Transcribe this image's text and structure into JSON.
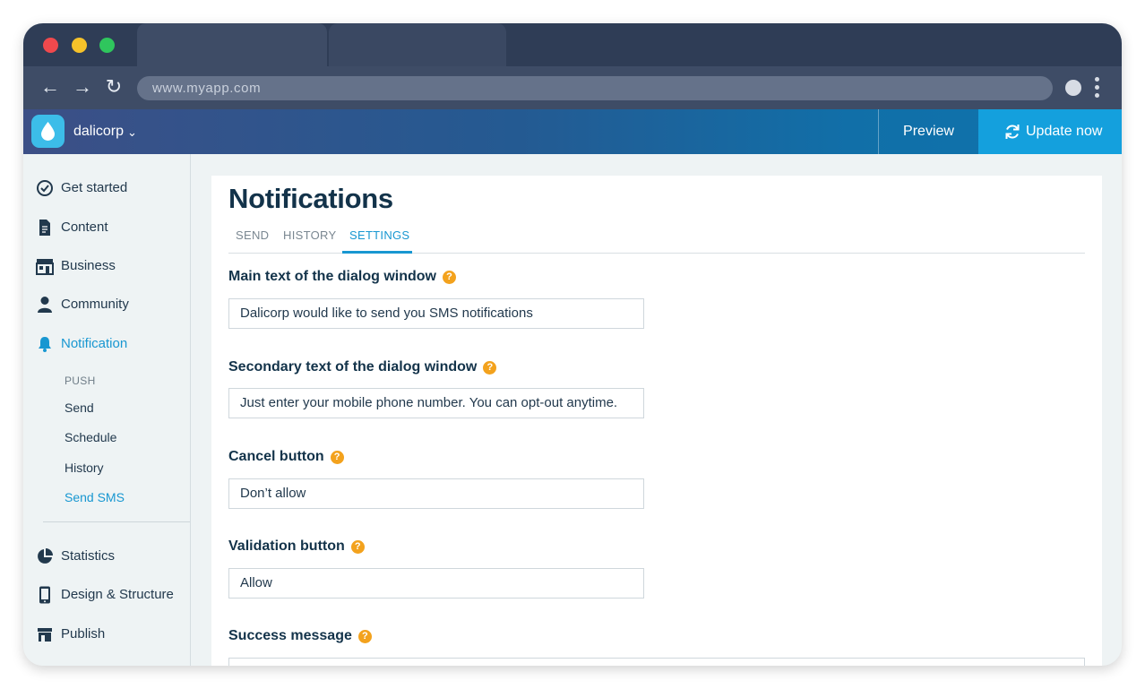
{
  "browser": {
    "url": "www.myapp.com",
    "back_glyph": "←",
    "forward_glyph": "→",
    "reload_glyph": "↻"
  },
  "header": {
    "org_name": "dalicorp",
    "org_chevron": "⌄",
    "preview_label": "Preview",
    "update_label": "Update now",
    "brand_color": "#14a0dd"
  },
  "sidebar": {
    "items": [
      {
        "label": "Get started",
        "icon": "check-circle-icon"
      },
      {
        "label": "Content",
        "icon": "document-icon"
      },
      {
        "label": "Business",
        "icon": "storefront-icon"
      },
      {
        "label": "Community",
        "icon": "person-icon"
      },
      {
        "label": "Notification",
        "icon": "bell-icon",
        "active": true
      },
      {
        "label": "Statistics",
        "icon": "pie-chart-icon"
      },
      {
        "label": "Design & Structure",
        "icon": "phone-icon"
      },
      {
        "label": "Publish",
        "icon": "shop-icon"
      }
    ],
    "push_heading": "PUSH",
    "sub_items": [
      "Send",
      "Schedule",
      "History",
      "Send SMS"
    ],
    "active_sub_item": "Send SMS"
  },
  "main": {
    "title": "Notifications",
    "tabs": [
      "SEND",
      "HISTORY",
      "SETTINGS"
    ],
    "active_tab": "SETTINGS",
    "help_glyph": "?",
    "fields": [
      {
        "label": "Main text of the dialog window",
        "value": "Dalicorp would like to send you SMS notifications"
      },
      {
        "label": "Secondary text of the dialog window",
        "value": "Just enter your mobile phone number. You can opt-out anytime."
      },
      {
        "label": "Cancel button",
        "value": "Don’t allow"
      },
      {
        "label": "Validation button",
        "value": "Allow"
      },
      {
        "label": "Success message",
        "value": ""
      }
    ]
  },
  "colors": {
    "accent": "#1897d1",
    "help": "#f3a21d",
    "title": "#13334a"
  }
}
